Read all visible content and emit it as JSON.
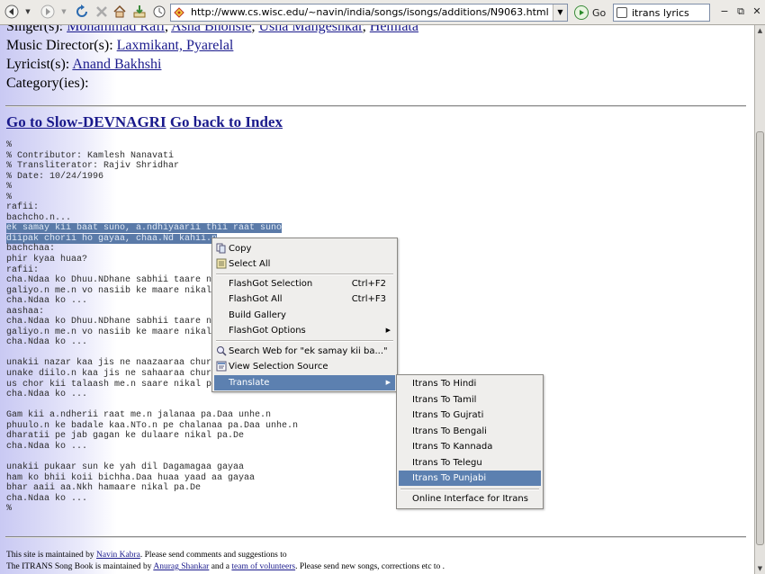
{
  "browser": {
    "url": "http://www.cs.wisc.edu/~navin/india/songs/isongs/additions/N9063.html",
    "go_label": "Go",
    "search_value": "itrans lyrics"
  },
  "meta": {
    "singers_label": "Singer(s):",
    "singers": [
      "Mohammad Rafi",
      "Asha Bhonsle",
      "Usha Mangeshkar",
      "Hemlata"
    ],
    "music_label": "Music Director(s):",
    "music": [
      "Laxmikant, Pyarelal"
    ],
    "lyricist_label": "Lyricist(s):",
    "lyricist": "Anand Bakhshi",
    "category_label": "Category(ies):"
  },
  "nav": {
    "devnagri": "Go to Slow-DEVNAGRI",
    "index": "Go back to Index"
  },
  "lyrics": [
    "%",
    "% Contributor: Kamlesh Nanavati",
    "% Transliterator: Rajiv Shridhar",
    "% Date: 10/24/1996",
    "%",
    "%",
    "rafii:",
    "bachcho.n...",
    "ek samay kii baat suno, a.ndhiyaarii thii raat suno",
    "diipak chorii ho gayaa, chaa.Nd kahii.n",
    "bachchaa:",
    "phir kyaa huaa?",
    "rafii:",
    "cha.Ndaa ko Dhuu.NDhane sabhii taare nik",
    "galiyo.n me.n vo nasiib ke maare nikal p",
    "cha.Ndaa ko ...",
    "aashaa:",
    "cha.Ndaa ko Dhuu.NDhane sabhii taare nik",
    "galiyo.n me.n vo nasiib ke maare nikal p",
    "cha.Ndaa ko ...",
    "",
    "unakii nazar kaa jis ne naazaaraa churaa",
    "unake diilo.n kaa jis ne sahaaraa churaa",
    "us chor kii talaash me.n saare nikal pa.",
    "cha.Ndaa ko ...",
    "",
    "Gam kii a.ndherii raat me.n jalanaa pa.Daa unhe.n",
    "phuulo.n ke badale kaa.NTo.n pe chalanaa pa.Daa unhe.n",
    "dharatii pe jab gagan ke dulaare nikal pa.De",
    "cha.Ndaa ko ...",
    "",
    "unakii pukaar sun ke yah dil Dagamagaa gayaa",
    "ham ko bhii koii bichha.Daa huaa yaad aa gayaa",
    "bhar aaii aa.Nkh hamaare nikal pa.De",
    "cha.Ndaa ko ...",
    "%"
  ],
  "footer": {
    "line1_pre": "This site is maintained by ",
    "line1_link": "Navin Kabra",
    "line1_post": ". Please send comments and suggestions to",
    "line2_pre": "The ITRANS Song Book is maintained by ",
    "line2_link1": "Anurag Shankar",
    "line2_mid": " and a ",
    "line2_link2": "team of volunteers",
    "line2_post": ". Please send new songs, corrections etc to ."
  },
  "context_menu": {
    "copy": "Copy",
    "select_all": "Select All",
    "flashgot_selection": "FlashGot Selection",
    "flashgot_selection_shortcut": "Ctrl+F2",
    "flashgot_all": "FlashGot All",
    "flashgot_all_shortcut": "Ctrl+F3",
    "build_gallery": "Build Gallery",
    "flashgot_options": "FlashGot Options",
    "search_web": "Search Web for \"ek samay kii ba...\"",
    "view_selection_source": "View Selection Source",
    "translate": "Translate"
  },
  "translate_submenu": [
    "Itrans To Hindi",
    "Itrans To Tamil",
    "Itrans To Gujrati",
    "Itrans To Bengali",
    "Itrans To Kannada",
    "Itrans To Telegu",
    "Itrans To Punjabi",
    "Online Interface for Itrans"
  ],
  "colors": {
    "highlight": "#5c80b0",
    "link": "#1a1a8c",
    "selection": "#5a7aa8"
  }
}
